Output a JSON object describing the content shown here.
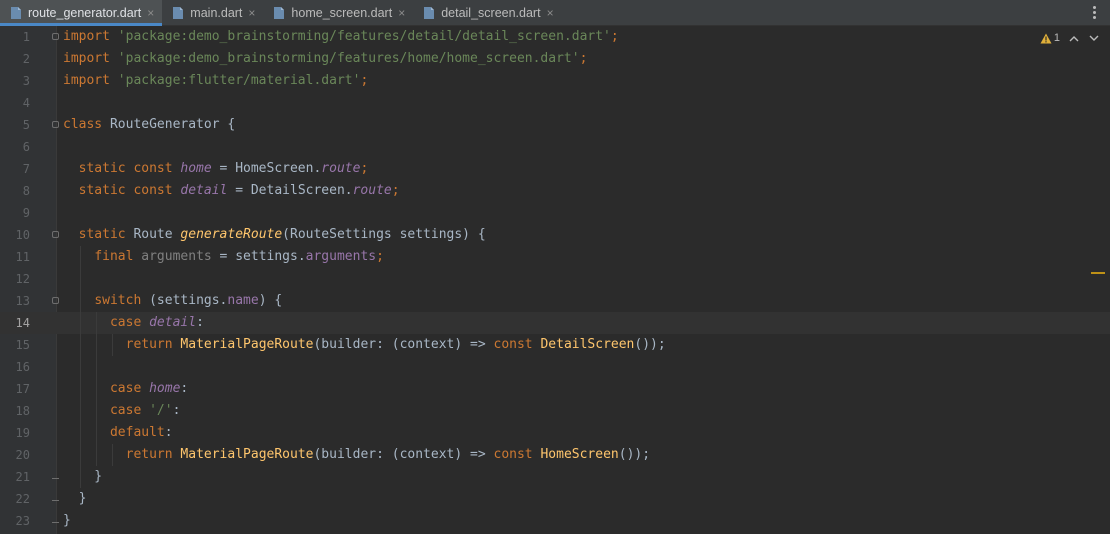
{
  "tabs": [
    {
      "label": "route_generator.dart",
      "close": "×",
      "active": true
    },
    {
      "label": "main.dart",
      "close": "×",
      "active": false
    },
    {
      "label": "home_screen.dart",
      "close": "×",
      "active": false
    },
    {
      "label": "detail_screen.dart",
      "close": "×",
      "active": false
    }
  ],
  "inspections": {
    "warning_count": "1"
  },
  "lines": [
    {
      "num": "1",
      "tokens": [
        [
          "kw",
          "import"
        ],
        [
          "plain",
          " "
        ],
        [
          "str",
          "'package:demo_brainstorming/features/detail/detail_screen.dart'"
        ],
        [
          "kw",
          ";"
        ]
      ]
    },
    {
      "num": "2",
      "tokens": [
        [
          "kw",
          "import"
        ],
        [
          "plain",
          " "
        ],
        [
          "str",
          "'package:demo_brainstorming/features/home/home_screen.dart'"
        ],
        [
          "kw",
          ";"
        ]
      ]
    },
    {
      "num": "3",
      "tokens": [
        [
          "kw",
          "import"
        ],
        [
          "plain",
          " "
        ],
        [
          "str",
          "'package:flutter/material.dart'"
        ],
        [
          "kw",
          ";"
        ]
      ]
    },
    {
      "num": "4",
      "tokens": []
    },
    {
      "num": "5",
      "tokens": [
        [
          "kw",
          "class"
        ],
        [
          "plain",
          " RouteGenerator {"
        ]
      ]
    },
    {
      "num": "6",
      "tokens": []
    },
    {
      "num": "7",
      "tokens": [
        [
          "plain",
          "  "
        ],
        [
          "kw",
          "static const"
        ],
        [
          "plain",
          " "
        ],
        [
          "fld",
          "home"
        ],
        [
          "plain",
          " = HomeScreen."
        ],
        [
          "fld",
          "route"
        ],
        [
          "kw",
          ";"
        ]
      ]
    },
    {
      "num": "8",
      "tokens": [
        [
          "plain",
          "  "
        ],
        [
          "kw",
          "static const"
        ],
        [
          "plain",
          " "
        ],
        [
          "fld",
          "detail"
        ],
        [
          "plain",
          " = DetailScreen."
        ],
        [
          "fld",
          "route"
        ],
        [
          "kw",
          ";"
        ]
      ]
    },
    {
      "num": "9",
      "tokens": []
    },
    {
      "num": "10",
      "tokens": [
        [
          "plain",
          "  "
        ],
        [
          "kw",
          "static"
        ],
        [
          "plain",
          " Route "
        ],
        [
          "fn",
          "generateRoute"
        ],
        [
          "plain",
          "(RouteSettings settings) {"
        ]
      ]
    },
    {
      "num": "11",
      "tokens": [
        [
          "plain",
          "    "
        ],
        [
          "kw",
          "final"
        ],
        [
          "plain",
          " "
        ],
        [
          "unused",
          "arguments"
        ],
        [
          "plain",
          " = settings."
        ],
        [
          "prop",
          "arguments"
        ],
        [
          "kw",
          ";"
        ]
      ]
    },
    {
      "num": "12",
      "tokens": []
    },
    {
      "num": "13",
      "tokens": [
        [
          "plain",
          "    "
        ],
        [
          "kw",
          "switch"
        ],
        [
          "plain",
          " (settings."
        ],
        [
          "prop",
          "name"
        ],
        [
          "plain",
          ") {"
        ]
      ]
    },
    {
      "num": "14",
      "tokens": [
        [
          "plain",
          "      "
        ],
        [
          "kw",
          "case"
        ],
        [
          "plain",
          " "
        ],
        [
          "fld",
          "detail"
        ],
        [
          "plain",
          ":"
        ]
      ]
    },
    {
      "num": "15",
      "tokens": [
        [
          "plain",
          "        "
        ],
        [
          "kw",
          "return"
        ],
        [
          "plain",
          " "
        ],
        [
          "cls",
          "MaterialPageRoute"
        ],
        [
          "plain",
          "(builder: (context) => "
        ],
        [
          "kw",
          "const"
        ],
        [
          "plain",
          " "
        ],
        [
          "cls",
          "DetailScreen"
        ],
        [
          "plain",
          "());"
        ]
      ]
    },
    {
      "num": "16",
      "tokens": []
    },
    {
      "num": "17",
      "tokens": [
        [
          "plain",
          "      "
        ],
        [
          "kw",
          "case"
        ],
        [
          "plain",
          " "
        ],
        [
          "fld",
          "home"
        ],
        [
          "plain",
          ":"
        ]
      ]
    },
    {
      "num": "18",
      "tokens": [
        [
          "plain",
          "      "
        ],
        [
          "kw",
          "case"
        ],
        [
          "plain",
          " "
        ],
        [
          "str",
          "'/'"
        ],
        [
          "plain",
          ":"
        ]
      ]
    },
    {
      "num": "19",
      "tokens": [
        [
          "plain",
          "      "
        ],
        [
          "kw",
          "default"
        ],
        [
          "plain",
          ":"
        ]
      ]
    },
    {
      "num": "20",
      "tokens": [
        [
          "plain",
          "        "
        ],
        [
          "kw",
          "return"
        ],
        [
          "plain",
          " "
        ],
        [
          "cls",
          "MaterialPageRoute"
        ],
        [
          "plain",
          "(builder: (context) => "
        ],
        [
          "kw",
          "const"
        ],
        [
          "plain",
          " "
        ],
        [
          "cls",
          "HomeScreen"
        ],
        [
          "plain",
          "());"
        ]
      ]
    },
    {
      "num": "21",
      "tokens": [
        [
          "plain",
          "    }"
        ]
      ]
    },
    {
      "num": "22",
      "tokens": [
        [
          "plain",
          "  }"
        ]
      ]
    },
    {
      "num": "23",
      "tokens": [
        [
          "plain",
          "}"
        ]
      ]
    }
  ],
  "current_line": "14"
}
